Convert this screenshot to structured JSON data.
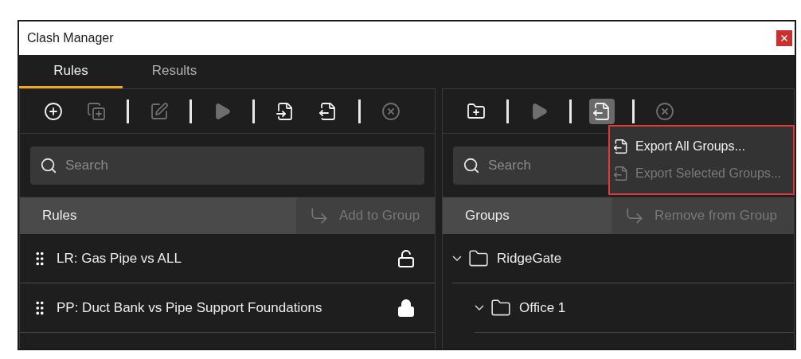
{
  "window": {
    "title": "Clash Manager"
  },
  "tabs": [
    {
      "label": "Rules",
      "selected": true
    },
    {
      "label": "Results",
      "selected": false
    }
  ],
  "rules_panel": {
    "toolbar": [
      {
        "kind": "add",
        "disabled": false,
        "pressed": false
      },
      {
        "kind": "duplicate",
        "disabled": true,
        "pressed": false
      },
      {
        "kind": "separator"
      },
      {
        "kind": "edit",
        "disabled": true,
        "pressed": false
      },
      {
        "kind": "separator"
      },
      {
        "kind": "run",
        "disabled": true,
        "pressed": false
      },
      {
        "kind": "separator"
      },
      {
        "kind": "import",
        "disabled": false,
        "pressed": false
      },
      {
        "kind": "export",
        "disabled": false,
        "pressed": false
      },
      {
        "kind": "separator"
      },
      {
        "kind": "delete",
        "disabled": true,
        "pressed": false
      }
    ],
    "search": {
      "placeholder": "Search"
    },
    "header": {
      "label": "Rules",
      "action": {
        "label": "Add to Group",
        "disabled": true
      }
    },
    "rules": [
      {
        "name": "LR: Gas Pipe vs ALL",
        "locked": false
      },
      {
        "name": "PP: Duct Bank vs Pipe Support Foundations",
        "locked": true
      }
    ]
  },
  "groups_panel": {
    "toolbar": [
      {
        "kind": "new_group",
        "disabled": false,
        "pressed": false
      },
      {
        "kind": "separator"
      },
      {
        "kind": "run",
        "disabled": true,
        "pressed": false
      },
      {
        "kind": "separator"
      },
      {
        "kind": "export",
        "disabled": false,
        "pressed": true
      },
      {
        "kind": "separator"
      },
      {
        "kind": "delete",
        "disabled": true,
        "pressed": false
      }
    ],
    "search": {
      "placeholder": "Search"
    },
    "header": {
      "label": "Groups",
      "action": {
        "label": "Remove from Group",
        "disabled": true
      }
    },
    "tree": [
      {
        "label": "RidgeGate",
        "expanded": true,
        "children": [
          {
            "label": "Office 1",
            "expanded": true
          }
        ]
      }
    ],
    "menu": [
      {
        "label": "Export All Groups...",
        "disabled": false
      },
      {
        "label": "Export Selected Groups...",
        "disabled": true
      }
    ]
  }
}
